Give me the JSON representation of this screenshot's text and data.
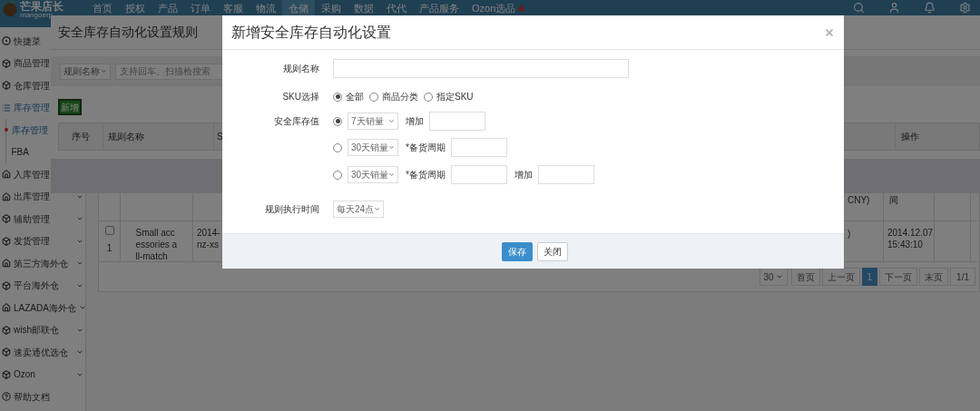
{
  "nav": {
    "logo": "芒果店长",
    "logo_domain": "mangoerp",
    "items": [
      {
        "label": "首页",
        "selected": false
      },
      {
        "label": "授权",
        "selected": false
      },
      {
        "label": "产品",
        "selected": false
      },
      {
        "label": "订单",
        "selected": false
      },
      {
        "label": "客服",
        "selected": false
      },
      {
        "label": "物流",
        "selected": false
      },
      {
        "label": "仓储",
        "selected": true
      },
      {
        "label": "采购",
        "selected": false
      },
      {
        "label": "数据",
        "selected": false
      },
      {
        "label": "代代",
        "selected": false
      },
      {
        "label": "产品服务",
        "selected": false
      },
      {
        "label": "Ozon选品",
        "selected": false,
        "badge": true
      }
    ]
  },
  "sidebar": {
    "items": [
      {
        "label": "快捷菜",
        "kind": "gear",
        "selected": false,
        "collapsible": false
      },
      {
        "label": "商品管理",
        "kind": "cube",
        "selected": false,
        "collapsible": false
      },
      {
        "label": "仓库管理",
        "kind": "cube",
        "selected": false,
        "collapsible": false
      },
      {
        "label": "库存管理",
        "kind": "list",
        "selected": true,
        "collapsible": false,
        "children": [
          {
            "label": "库存管理",
            "selected": true
          },
          {
            "label": "FBA",
            "selected": false
          }
        ]
      },
      {
        "label": "入库管理",
        "kind": "house",
        "selected": false,
        "collapsible": false
      },
      {
        "label": "出库管理",
        "kind": "house",
        "selected": false,
        "collapsible": true
      },
      {
        "label": "辅助管理",
        "kind": "cube",
        "selected": false,
        "collapsible": true
      },
      {
        "label": "发货管理",
        "kind": "cube",
        "selected": false,
        "collapsible": true
      },
      {
        "label": "第三方海外仓",
        "kind": "house",
        "selected": false,
        "collapsible": true
      },
      {
        "label": "平台海外仓",
        "kind": "cube",
        "selected": false,
        "collapsible": true
      },
      {
        "label": "LAZADA海外仓",
        "kind": "house",
        "selected": false,
        "collapsible": true
      },
      {
        "label": "wish邮联仓",
        "kind": "cube",
        "selected": false,
        "collapsible": true
      },
      {
        "label": "速卖通优选仓",
        "kind": "cube",
        "selected": false,
        "collapsible": true
      },
      {
        "label": "Ozon",
        "kind": "cube",
        "selected": false,
        "collapsible": true
      },
      {
        "label": "帮助文档",
        "kind": "help",
        "selected": false,
        "collapsible": false
      }
    ]
  },
  "table": {
    "header": {
      "column_5": "CNY)",
      "column_6": "间"
    },
    "rows": [
      {
        "checked": false,
        "column_1": "1",
        "column_2": "Small accessories all-match",
        "column_3": [
          "2014-",
          "nz-xs"
        ],
        "column_5": ")",
        "column_6": "2014.12.07 15:43:10"
      }
    ]
  },
  "pagination": {
    "page_size": "30",
    "buttons": [
      {
        "label": "首页",
        "selected": false
      },
      {
        "label": "上一页",
        "selected": false
      },
      {
        "label": "1",
        "selected": true
      },
      {
        "label": "下一页",
        "selected": false
      },
      {
        "label": "末页",
        "selected": false
      }
    ],
    "page_count": "1/1"
  },
  "rules_dialog": {
    "title": "安全库存自动化设置规则",
    "filter": "规则名称",
    "search_placeholder": "支持回车、扫描枪搜索",
    "add_button": "新增",
    "columns": [
      "序号",
      "规则名称",
      "S",
      "操作"
    ]
  },
  "add_dialog": {
    "title": "新增安全库存自动化设置",
    "rule_name": {
      "label": "规则名称"
    },
    "sku": {
      "label": "SKU选择",
      "options": [
        {
          "label": "全部",
          "selected": true
        },
        {
          "label": "商品分类",
          "selected": false
        },
        {
          "label": "指定SKU",
          "selected": false
        }
      ]
    },
    "safety_stock": {
      "label": "安全库存值",
      "options": [
        {
          "selected": true,
          "basis": "7天销量",
          "parts": [
            {
              "kind": "label",
              "text": "增加"
            },
            {
              "kind": "input"
            }
          ]
        },
        {
          "selected": false,
          "basis": "30天销量",
          "parts": [
            {
              "kind": "label",
              "text": "*备货周期"
            },
            {
              "kind": "input"
            }
          ]
        },
        {
          "selected": false,
          "basis": "30天销量",
          "parts": [
            {
              "kind": "label",
              "text": "*备货周期"
            },
            {
              "kind": "input"
            },
            {
              "kind": "label",
              "text": "增加"
            },
            {
              "kind": "input"
            }
          ]
        }
      ]
    },
    "run_time": {
      "label": "规则执行时间",
      "value": "每天24点"
    },
    "buttons": [
      {
        "label": "保存",
        "kind": "primary"
      },
      {
        "label": "关闭",
        "kind": "default"
      }
    ]
  }
}
